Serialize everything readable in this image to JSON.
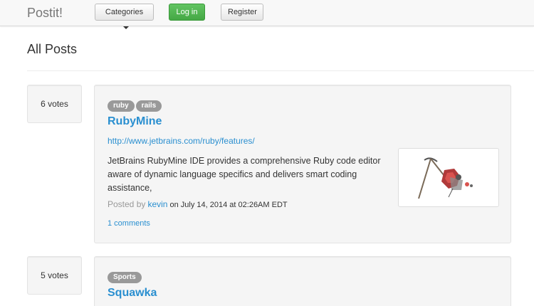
{
  "navbar": {
    "brand": "Postit!",
    "categories_label": "Categories",
    "login_label": "Log in",
    "register_label": "Register"
  },
  "page": {
    "title": "All Posts"
  },
  "posts": [
    {
      "votes": "6 votes",
      "tags": [
        "ruby",
        "rails"
      ],
      "title": "RubyMine",
      "url": "http://www.jetbrains.com/ruby/features/",
      "description": "JetBrains RubyMine IDE provides a comprehensive Ruby code editor aware of dynamic language specifics and delivers smart coding assistance,",
      "posted_by_label": "Posted by",
      "author": "kevin",
      "date_text": "on July 14, 2014 at 02:26AM EDT",
      "comments": "1 comments"
    },
    {
      "votes": "5 votes",
      "tags": [
        "Sports"
      ],
      "title": "Squawka"
    }
  ],
  "colors": {
    "link": "#2a8fd0",
    "success": "#5cb85c",
    "tag": "#999999"
  }
}
